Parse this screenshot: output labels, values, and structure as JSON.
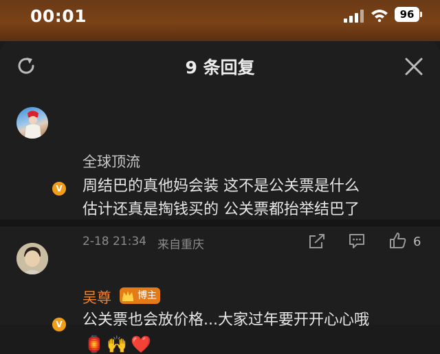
{
  "status_bar": {
    "time": "00:01",
    "battery": "96"
  },
  "sheet": {
    "title": "9 条回复"
  },
  "comments": [
    {
      "username": "全球顶流",
      "lines": [
        "周结巴的真他妈会装 这不是公关票是什么",
        "估计还真是掏钱买的 公关票都抬举结巴了"
      ],
      "timestamp": "2-18 21:34",
      "location": "来自重庆",
      "likes": "6"
    },
    {
      "username": "吴尊",
      "badge": "博主",
      "text": "公关票也会放价格...大家过年要开开心心哦",
      "emojis": [
        "🏮",
        "🙌",
        "❤️"
      ]
    }
  ],
  "colors": {
    "accent": "#f0822c",
    "verified": "#f29d18",
    "host_badge": "#e57b16"
  },
  "icons": [
    "refresh-icon",
    "close-icon",
    "share-icon",
    "comment-icon",
    "like-icon",
    "verified-icon",
    "crown-icon"
  ]
}
